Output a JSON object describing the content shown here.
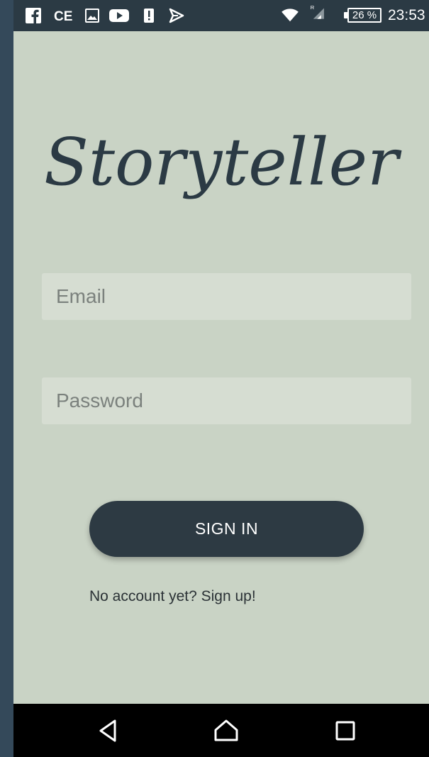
{
  "status_bar": {
    "icons_left": [
      "facebook-icon",
      "cc-icon",
      "gallery-icon",
      "youtube-icon",
      "alert-icon",
      "send-icon"
    ],
    "icons_right": [
      "wifi-icon",
      "signal-roaming-icon"
    ],
    "battery_percent": "26 %",
    "time": "23:53",
    "background": "#2b3a44"
  },
  "app": {
    "logo_text": "Storyteller",
    "logo_color": "#2b3a44",
    "background": "#c9d3c5"
  },
  "form": {
    "email_placeholder": "Email",
    "password_placeholder": "Password",
    "signin_label": "SIGN IN",
    "signup_text": "No account yet? Sign up!"
  },
  "nav_bar": {
    "buttons": [
      "back-icon",
      "home-icon",
      "recents-icon"
    ]
  }
}
